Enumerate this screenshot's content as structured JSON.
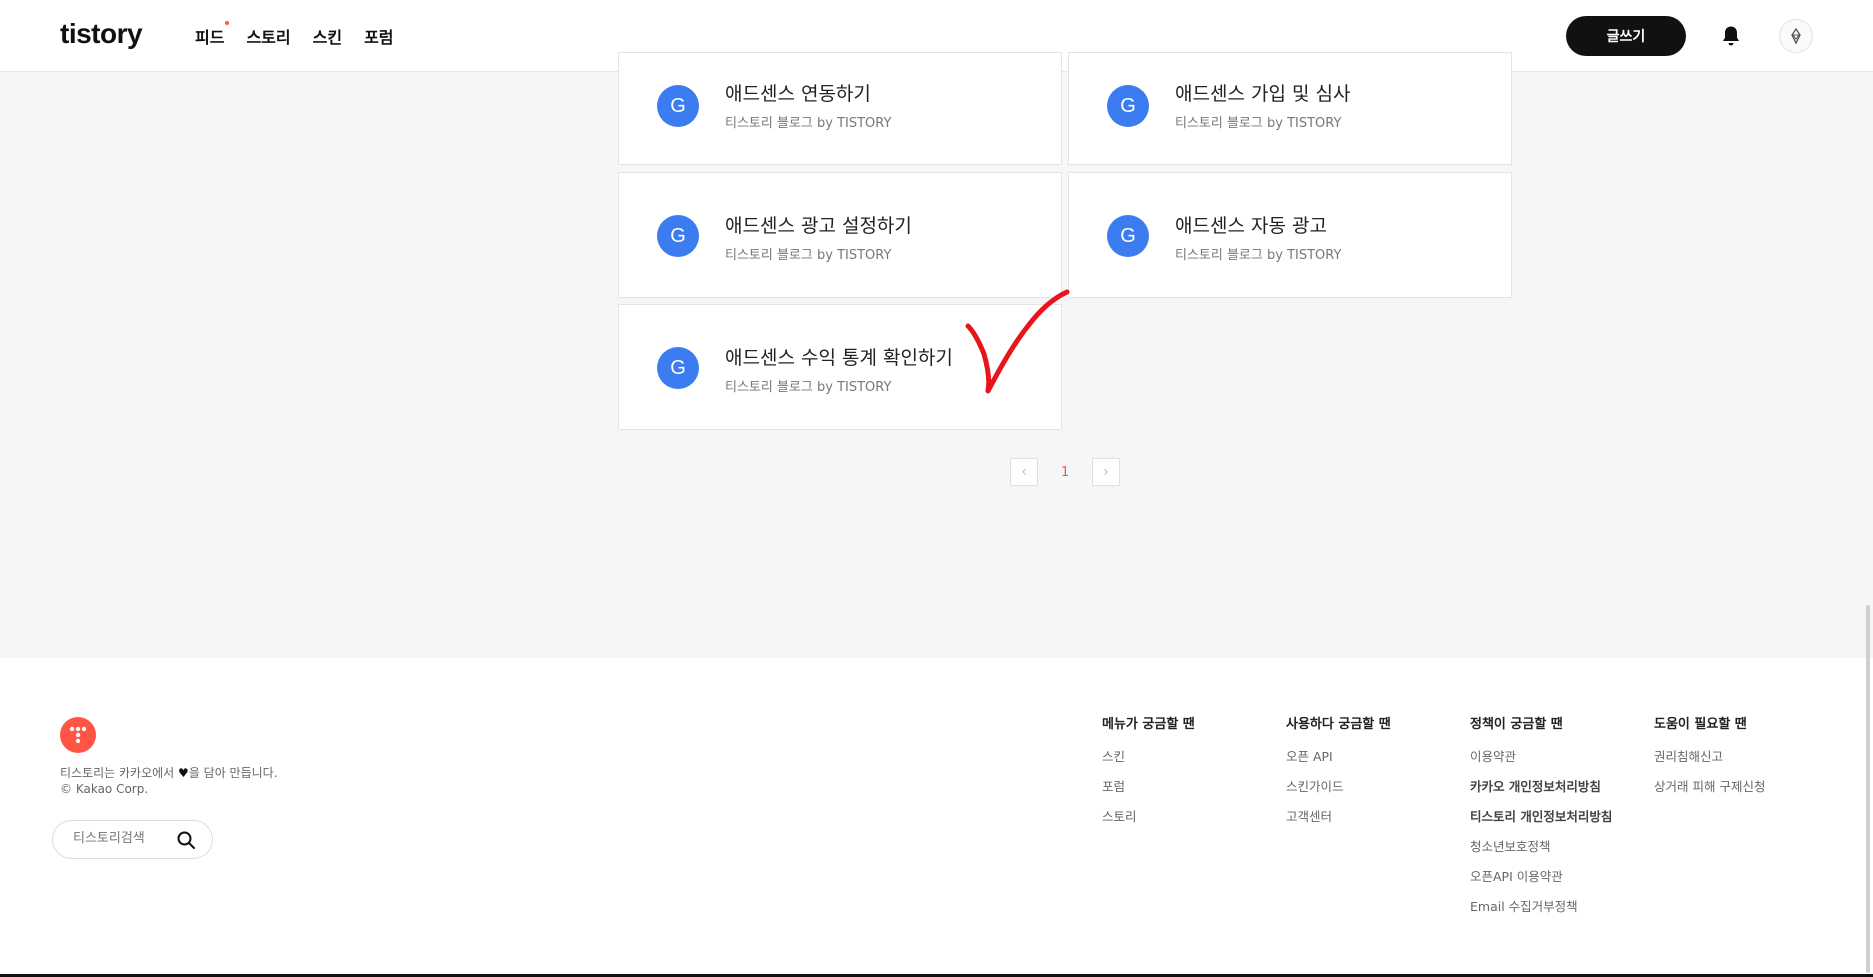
{
  "header": {
    "logo": "tistory",
    "nav": [
      {
        "label": "피드",
        "has_dot": true
      },
      {
        "label": "스토리",
        "has_dot": false
      },
      {
        "label": "스킨",
        "has_dot": false
      },
      {
        "label": "포럼",
        "has_dot": false
      }
    ],
    "write_label": "글쓰기",
    "bell_icon": "bell-icon",
    "avatar_icon": "profile-avatar-icon"
  },
  "cards": [
    {
      "icon": "G",
      "title": "애드센스 연동하기",
      "blog": "티스토리 블로그",
      "by": "by TISTORY"
    },
    {
      "icon": "G",
      "title": "애드센스 가입 및 심사",
      "blog": "티스토리 블로그",
      "by": "by TISTORY"
    },
    {
      "icon": "G",
      "title": "애드센스 광고 설정하기",
      "blog": "티스토리 블로그",
      "by": "by TISTORY"
    },
    {
      "icon": "G",
      "title": "애드센스 자동 광고",
      "blog": "티스토리 블로그",
      "by": "by TISTORY"
    },
    {
      "icon": "G",
      "title": "애드센스 수익 통계 확인하기",
      "blog": "티스토리 블로그",
      "by": "by TISTORY"
    }
  ],
  "pagination": {
    "prev": "‹",
    "current": "1",
    "next": "›"
  },
  "accent_color": "#ff5544",
  "footer": {
    "tagline_pre": "티스토리는 카카오에서",
    "tagline_post": "을 담아 만듭니다.",
    "copyright": "© Kakao Corp.",
    "search_placeholder": "티스토리검색",
    "columns": [
      {
        "heading": "메뉴가 궁금할 땐",
        "items": [
          {
            "label": "스킨",
            "bold": false
          },
          {
            "label": "포럼",
            "bold": false
          },
          {
            "label": "스토리",
            "bold": false
          }
        ]
      },
      {
        "heading": "사용하다 궁금할 땐",
        "items": [
          {
            "label": "오픈 API",
            "bold": false
          },
          {
            "label": "스킨가이드",
            "bold": false
          },
          {
            "label": "고객센터",
            "bold": false
          }
        ]
      },
      {
        "heading": "정책이 궁금할 땐",
        "items": [
          {
            "label": "이용약관",
            "bold": false
          },
          {
            "label": "카카오 개인정보처리방침",
            "bold": true
          },
          {
            "label": "티스토리 개인정보처리방침",
            "bold": true
          },
          {
            "label": "청소년보호정책",
            "bold": false
          },
          {
            "label": "오픈API 이용약관",
            "bold": false
          },
          {
            "label": "Email 수집거부정책",
            "bold": false
          }
        ]
      },
      {
        "heading": "도움이 필요할 땐",
        "items": [
          {
            "label": "권리침해신고",
            "bold": false
          },
          {
            "label": "상거래 피해 구제신청",
            "bold": false
          }
        ]
      }
    ]
  }
}
